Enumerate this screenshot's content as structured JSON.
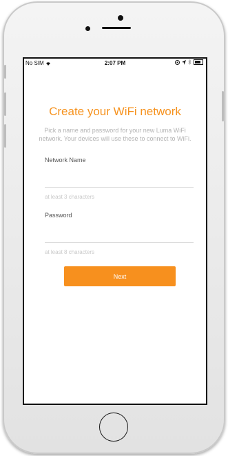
{
  "status_bar": {
    "carrier": "No SIM",
    "time": "2:07 PM"
  },
  "screen": {
    "title": "Create your WiFi network",
    "subtitle": "Pick a name and password for your new Luma WiFi network. Your devices will use these to connect to WiFi.",
    "network_name": {
      "label": "Network Name",
      "value": "",
      "hint": "at least 3 characters"
    },
    "password": {
      "label": "Password",
      "value": "",
      "hint": "at least 8 characters"
    },
    "next_label": "Next"
  },
  "colors": {
    "accent": "#f6921e",
    "subtitle": "#b3b3b3",
    "hint": "#c8c8c8"
  },
  "icons": [
    "wifi-icon",
    "location-icon",
    "bluetooth-icon",
    "battery-icon"
  ]
}
